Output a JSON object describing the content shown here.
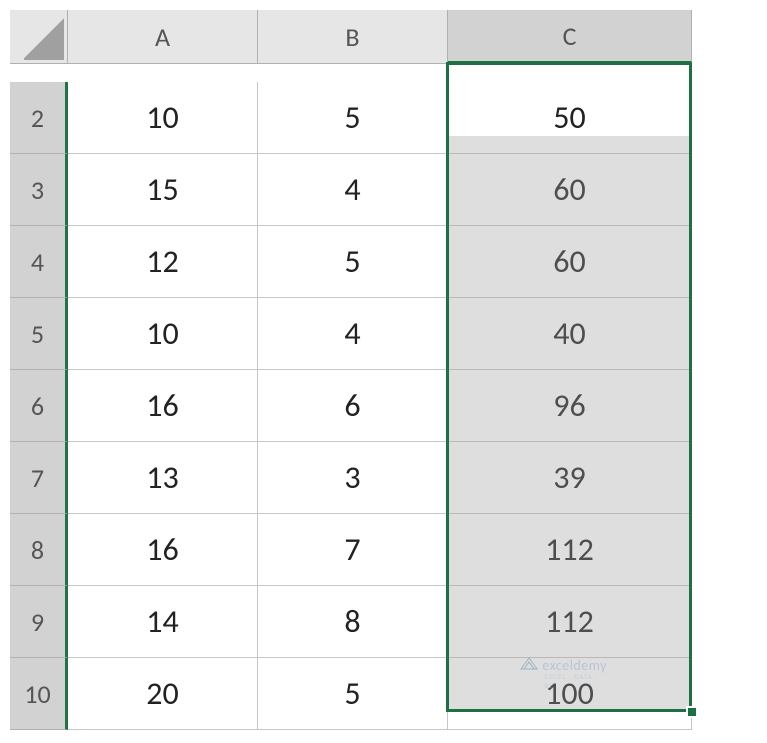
{
  "columns": {
    "A": "A",
    "B": "B",
    "C": "C"
  },
  "rows": [
    "2",
    "3",
    "4",
    "5",
    "6",
    "7",
    "8",
    "9",
    "10"
  ],
  "grid": {
    "A": [
      "10",
      "15",
      "12",
      "10",
      "16",
      "13",
      "16",
      "14",
      "20"
    ],
    "B": [
      "5",
      "4",
      "5",
      "4",
      "6",
      "3",
      "7",
      "8",
      "5"
    ],
    "C": [
      "50",
      "60",
      "60",
      "40",
      "96",
      "39",
      "112",
      "112",
      "100"
    ]
  },
  "selection": {
    "col": "C",
    "start_row": "2",
    "end_row": "10",
    "active_cell": "C2"
  },
  "watermark": {
    "brand": "exceldemy",
    "tagline": "EXCEL · DATA · BI"
  },
  "chart_data": {
    "type": "table",
    "title": "",
    "columns": [
      "A",
      "B",
      "C"
    ],
    "rows": [
      {
        "row": 2,
        "A": 10,
        "B": 5,
        "C": 50
      },
      {
        "row": 3,
        "A": 15,
        "B": 4,
        "C": 60
      },
      {
        "row": 4,
        "A": 12,
        "B": 5,
        "C": 60
      },
      {
        "row": 5,
        "A": 10,
        "B": 4,
        "C": 40
      },
      {
        "row": 6,
        "A": 16,
        "B": 6,
        "C": 96
      },
      {
        "row": 7,
        "A": 13,
        "B": 3,
        "C": 39
      },
      {
        "row": 8,
        "A": 16,
        "B": 7,
        "C": 112
      },
      {
        "row": 9,
        "A": 14,
        "B": 8,
        "C": 112
      },
      {
        "row": 10,
        "A": 20,
        "B": 5,
        "C": 100
      }
    ]
  }
}
